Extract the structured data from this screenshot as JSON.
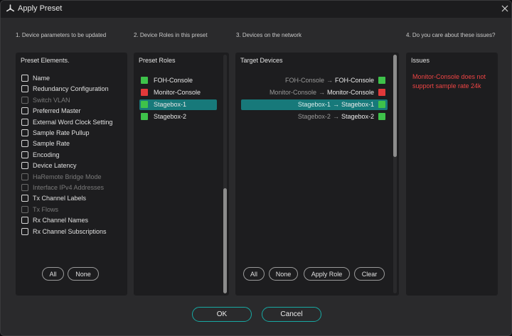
{
  "window": {
    "title": "Apply Preset"
  },
  "columns": {
    "col1_heading": "1. Device parameters to be updated",
    "col2_heading": "2. Device Roles in this preset",
    "col3_heading": "3. Devices on the network",
    "col4_heading": "4. Do you care about these issues?"
  },
  "preset_elements": {
    "title": "Preset Elements.",
    "items": [
      {
        "label": "Name",
        "enabled": true
      },
      {
        "label": "Redundancy Configuration",
        "enabled": true
      },
      {
        "label": "Switch VLAN",
        "enabled": false
      },
      {
        "label": "Preferred Master",
        "enabled": true
      },
      {
        "label": "External Word Clock Setting",
        "enabled": true
      },
      {
        "label": "Sample Rate Pullup",
        "enabled": true
      },
      {
        "label": "Sample Rate",
        "enabled": true
      },
      {
        "label": "Encoding",
        "enabled": true
      },
      {
        "label": "Device Latency",
        "enabled": true
      },
      {
        "label": "HaRemote Bridge Mode",
        "enabled": false
      },
      {
        "label": "Interface IPv4 Addresses",
        "enabled": false
      },
      {
        "label": "Tx Channel Labels",
        "enabled": true
      },
      {
        "label": "Tx Flows",
        "enabled": false
      },
      {
        "label": "Rx Channel Names",
        "enabled": true
      },
      {
        "label": "Rx Channel Subscriptions",
        "enabled": true
      }
    ],
    "all_label": "All",
    "none_label": "None"
  },
  "preset_roles": {
    "title": "Preset Roles",
    "items": [
      {
        "label": "FOH-Console",
        "status_color": "#3ec24a",
        "selected": false
      },
      {
        "label": "Monitor-Console",
        "status_color": "#e2393a",
        "selected": false
      },
      {
        "label": "Stagebox-1",
        "status_color": "#3ec24a",
        "selected": true
      },
      {
        "label": "Stagebox-2",
        "status_color": "#3ec24a",
        "selected": false
      }
    ]
  },
  "target_devices": {
    "title": "Target Devices",
    "items": [
      {
        "from": "FOH-Console",
        "to": "FOH-Console",
        "status_color": "#3ec24a",
        "selected": false
      },
      {
        "from": "Monitor-Console",
        "to": "Monitor-Console",
        "status_color": "#e2393a",
        "selected": false
      },
      {
        "from": "Stagebox-1",
        "to": "Stagebox-1",
        "status_color": "#3ec24a",
        "selected": true
      },
      {
        "from": "Stagebox-2",
        "to": "Stagebox-2",
        "status_color": "#3ec24a",
        "selected": false
      }
    ],
    "arrow": "→",
    "all_label": "All",
    "none_label": "None",
    "apply_role_label": "Apply Role",
    "clear_label": "Clear"
  },
  "issues": {
    "title": "Issues",
    "text": "Monitor-Console does not support sample rate 24k",
    "text_color": "#ee4444"
  },
  "footer": {
    "ok_label": "OK",
    "cancel_label": "Cancel"
  },
  "colors": {
    "accent": "#17a9a3",
    "selection": "#17797a",
    "ok_status": "#3ec24a",
    "error_status": "#e2393a"
  }
}
